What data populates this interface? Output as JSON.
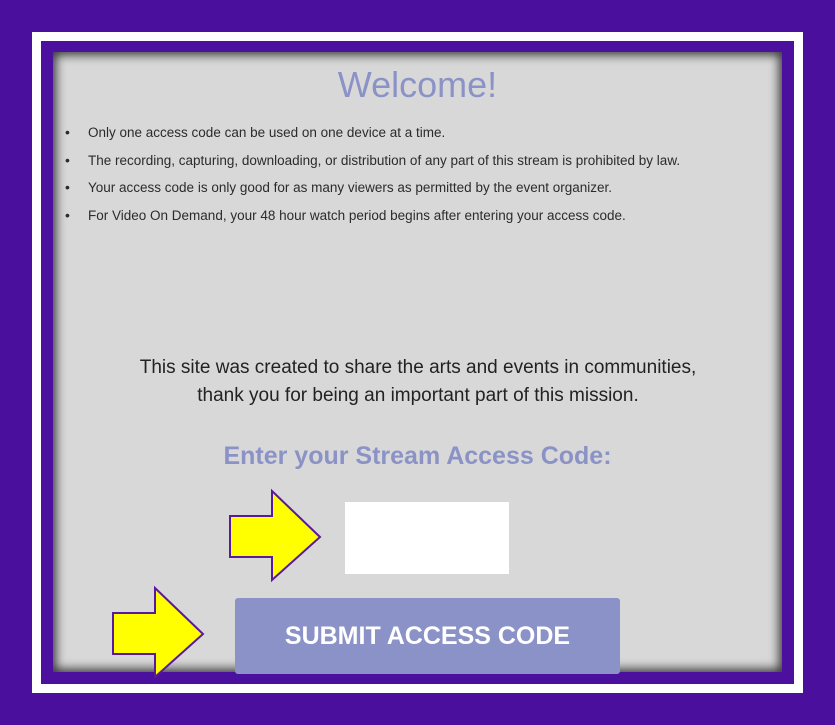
{
  "panel": {
    "title": "Welcome!",
    "rules": [
      "Only one access code can be used on one device at a time.",
      "The recording, capturing, downloading, or distribution of any part of this stream is prohibited by law.",
      "Your access code is only good for as many viewers as permitted by the event organizer.",
      "For Video On Demand, your 48 hour watch period begins after entering your access code."
    ],
    "mission_line1": "This site was created to share the arts and events in communities,",
    "mission_line2": "thank you for being an important part of this mission.",
    "code_label": "Enter your Stream Access Code:",
    "code_input": {
      "value": "",
      "placeholder": ""
    },
    "submit_label": "SUBMIT ACCESS CODE"
  },
  "annotations": {
    "arrow_color": "#ffff00",
    "arrow_outline": "#5a1a9e",
    "arrows": [
      {
        "icon": "right-arrow-icon",
        "target": "code-input"
      },
      {
        "icon": "right-arrow-icon",
        "target": "submit-button"
      }
    ]
  },
  "colors": {
    "background": "#4a0f9c",
    "panel": "#d8d8d8",
    "accent": "#8b93c6",
    "button": "#8a92c7"
  }
}
